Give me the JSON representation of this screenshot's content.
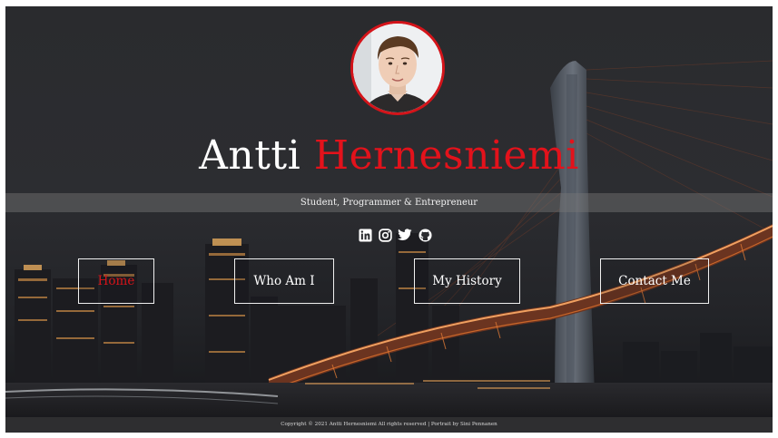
{
  "hero": {
    "first_name": "Antti",
    "last_name": "Hernesniemi",
    "tagline": "Student, Programmer & Entrepreneur"
  },
  "social_icons": [
    "linkedin-icon",
    "instagram-icon",
    "twitter-icon",
    "github-icon"
  ],
  "nav": {
    "home": "Home",
    "who": "Who Am I",
    "history": "My History",
    "contact": "Contact Me"
  },
  "footer": {
    "text": "Copyright © 2021 Antti Hernesniemi All rights reserved | Portrait by Sini Pennanen"
  },
  "colors": {
    "accent": "#e3121b",
    "background": "#2b2c2f",
    "text": "#ffffff"
  }
}
